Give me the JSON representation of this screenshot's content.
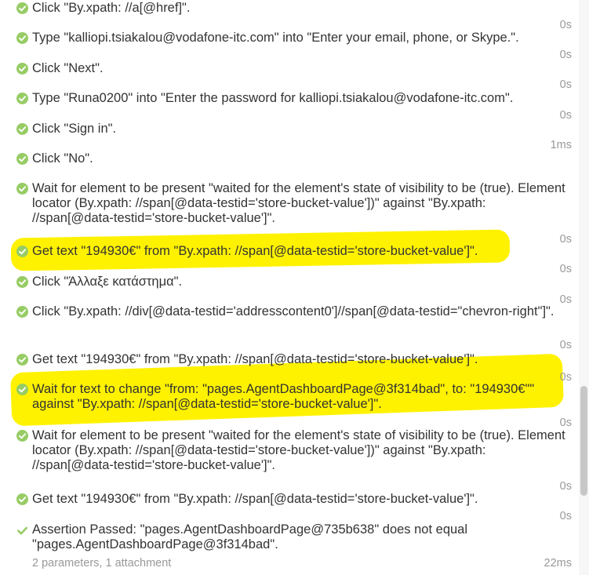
{
  "steps": [
    {
      "text": "Click \"By.xpath: //a[@href]\".",
      "duration": "0s"
    },
    {
      "text": "Type \"kalliopi.tsiakalou@vodafone-itc.com\" into \"Enter your email, phone, or Skype.\".",
      "duration": "0s"
    },
    {
      "text": "Click \"Next\".",
      "duration": "0s"
    },
    {
      "text": "Type \"Runa0200\" into \"Enter the password for kalliopi.tsiakalou@vodafone-itc.com\".",
      "duration": "0s"
    },
    {
      "text": "Click \"Sign in\".",
      "duration": "1ms"
    },
    {
      "text": "Click \"No\".",
      "duration": ""
    },
    {
      "text": "Wait for element to be present \"waited for the element's state of visibility to be (true). Element locator (By.xpath: //span[@data-testid='store-bucket-value'])\" against \"By.xpath: //span[@data-testid='store-bucket-value']\".",
      "duration": "0s"
    },
    {
      "text": "Get text \"194930€\" from \"By.xpath: //span[@data-testid='store-bucket-value']\".",
      "duration": "0s"
    },
    {
      "text": "Click \"Άλλαξε κατάστημα\".",
      "duration": "0s"
    },
    {
      "text": "Click \"By.xpath: //div[@data-testid='addresscontent0']//span[@data-testid=\"chevron-right\"]\".",
      "duration": "0s"
    },
    {
      "text": "Get text \"194930€\" from \"By.xpath: //span[@data-testid='store-bucket-value']\".",
      "duration": "0s"
    },
    {
      "text": "Wait for text to change \"from: \"pages.AgentDashboardPage@3f314bad\", to: \"194930€\"\" against \"By.xpath: //span[@data-testid='store-bucket-value']\".",
      "duration": "0s"
    },
    {
      "text": "Wait for element to be present \"waited for the element's state of visibility to be (true). Element locator (By.xpath: //span[@data-testid='store-bucket-value'])\" against \"By.xpath: //span[@data-testid='store-bucket-value']\".",
      "duration": "0s"
    },
    {
      "text": "Get text \"194930€\" from \"By.xpath: //span[@data-testid='store-bucket-value']\".",
      "duration": "0s"
    },
    {
      "text": "Assertion Passed: \"pages.AgentDashboardPage@735b638\" does not equal \"pages.AgentDashboardPage@3f314bad\".",
      "duration": "22ms",
      "meta": "2 parameters, 1 attachment"
    }
  ],
  "colors": {
    "passed": "#97cc64",
    "highlight": "#fff200",
    "text": "#333333",
    "muted": "#999999"
  },
  "icons": {
    "step_status": "check-circle-icon",
    "assertion_status": "check-mark-icon"
  },
  "scroll": {
    "position_fraction": 0.83
  }
}
